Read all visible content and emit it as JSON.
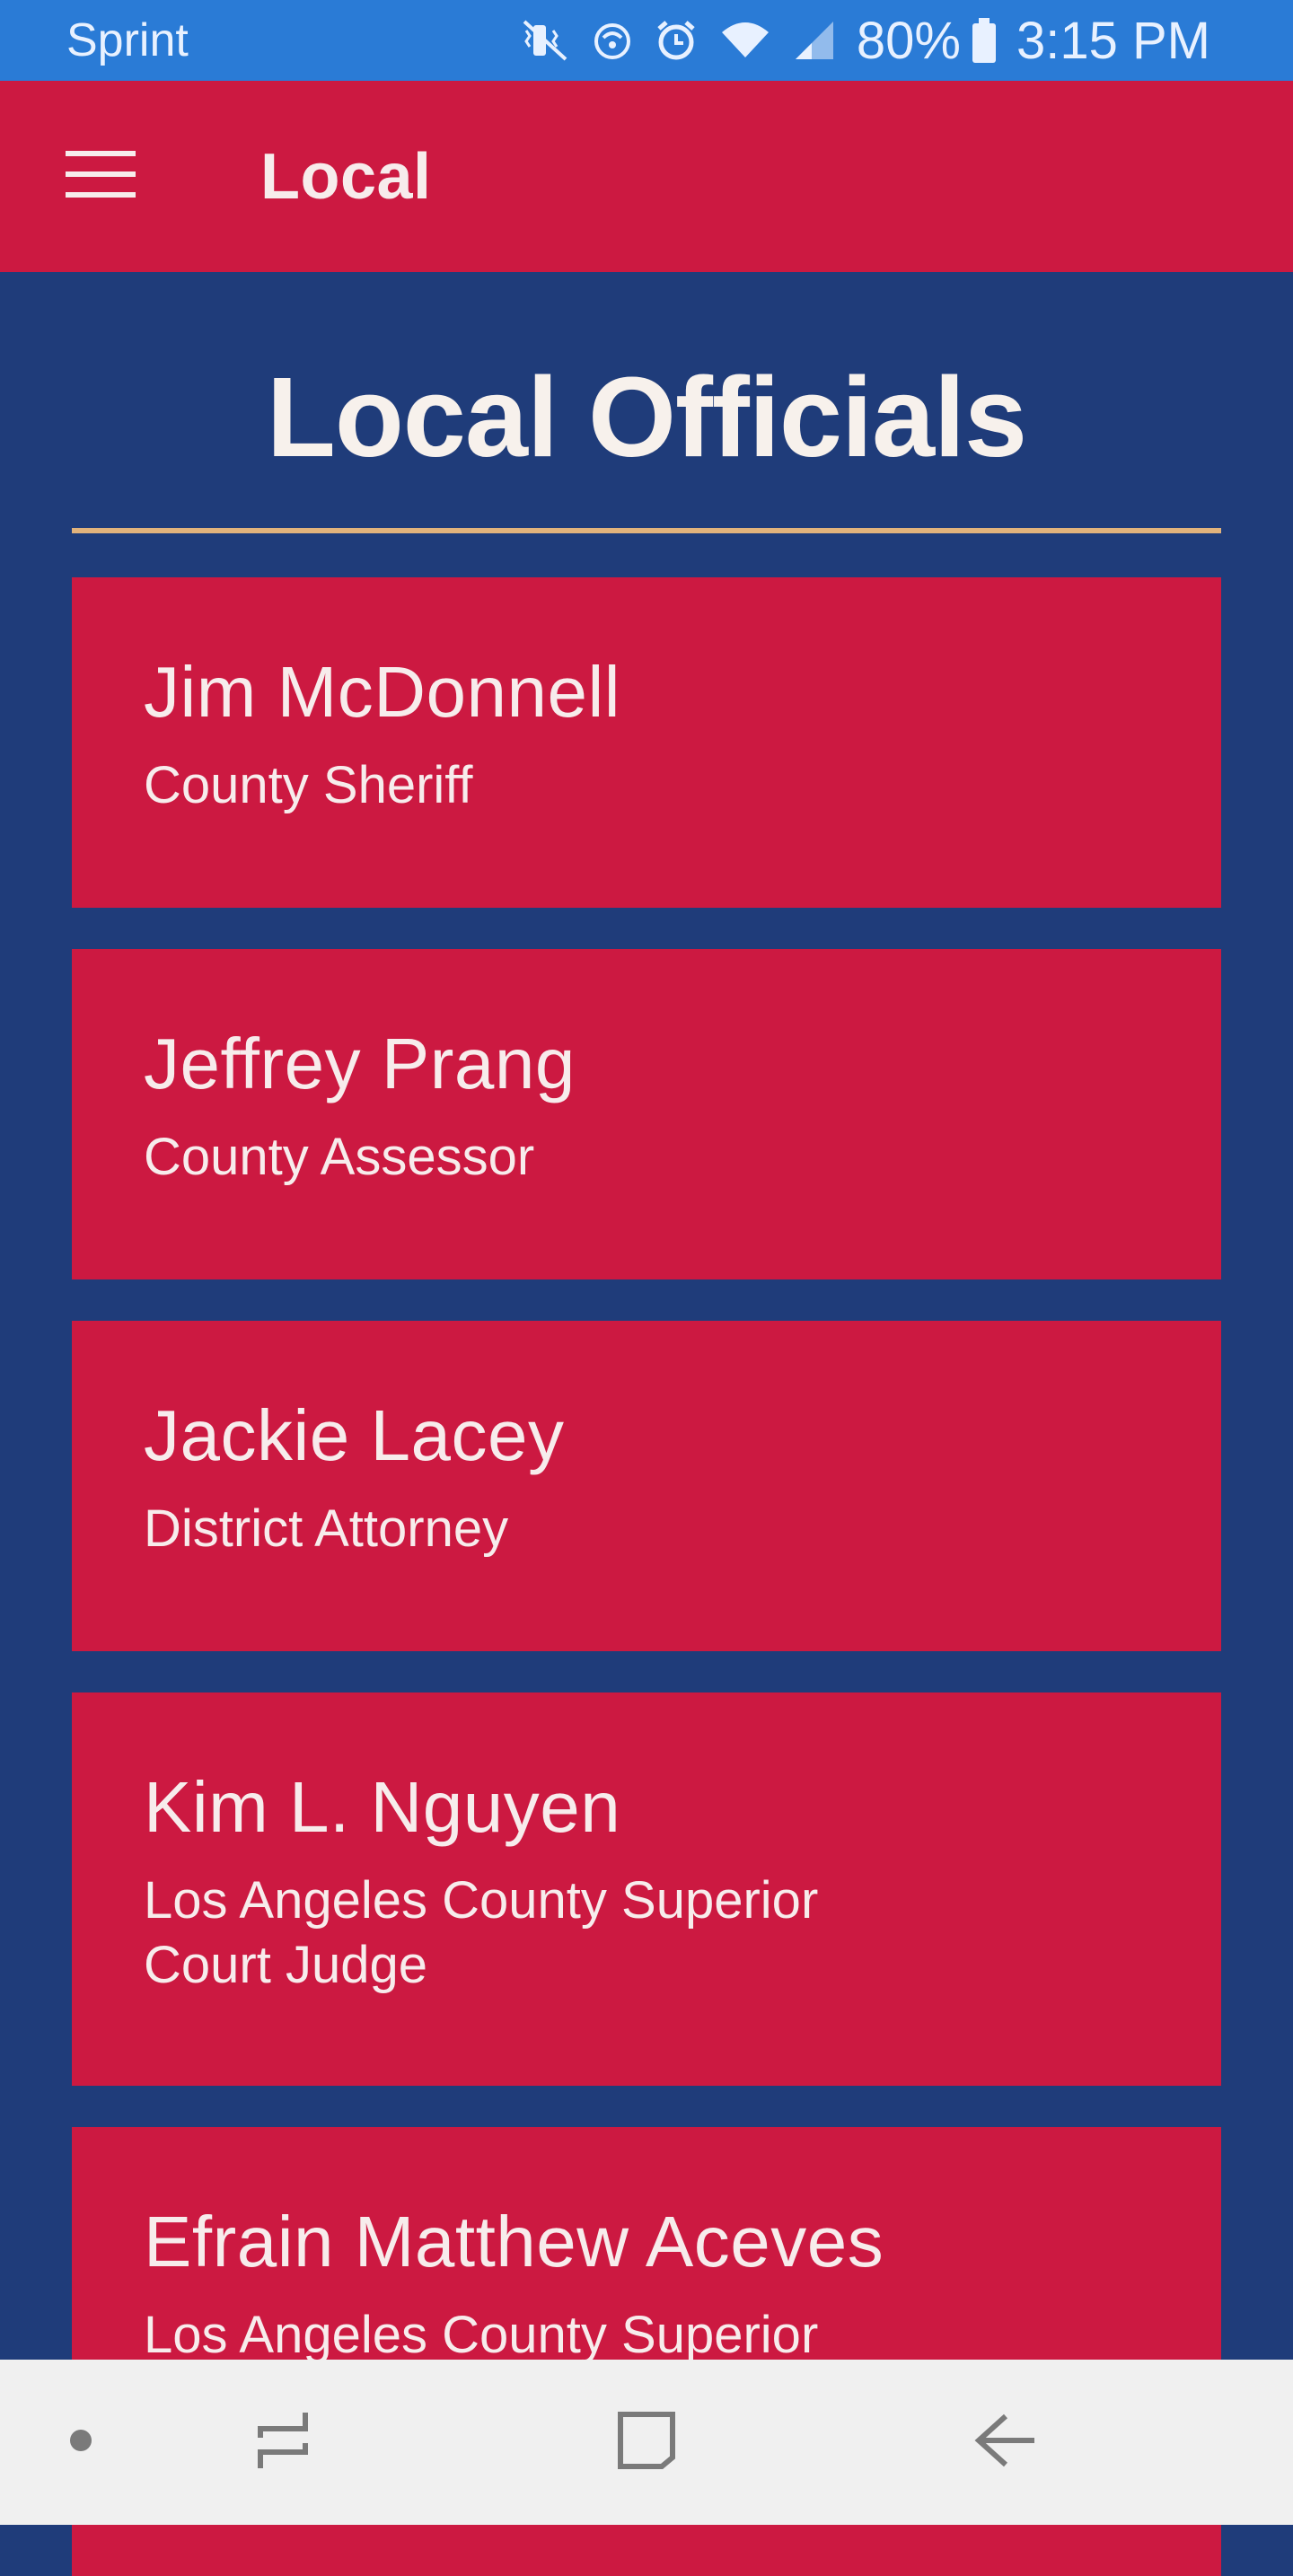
{
  "status_bar": {
    "carrier": "Sprint",
    "battery": "80%",
    "time": "3:15 PM",
    "icons": [
      "mute-vibrate-icon",
      "wifi-calling-icon",
      "alarm-icon",
      "wifi-icon",
      "cellular-signal-icon",
      "battery-icon"
    ]
  },
  "app_bar": {
    "title": "Local",
    "menu_icon": "hamburger-menu-icon"
  },
  "page": {
    "heading": "Local Officials"
  },
  "officials": [
    {
      "name": "Jim McDonnell",
      "title": "County Sheriff"
    },
    {
      "name": "Jeffrey Prang",
      "title": "County Assessor"
    },
    {
      "name": "Jackie Lacey",
      "title": "District Attorney"
    },
    {
      "name": "Kim L. Nguyen",
      "title": "Los Angeles County Superior Court Judge"
    },
    {
      "name": "Efrain Matthew Aceves",
      "title": "Los Angeles County Superior Court Judge"
    }
  ],
  "nav_bar": {
    "icons": [
      "dot-icon",
      "recent-apps-icon",
      "home-icon",
      "back-icon"
    ]
  },
  "colors": {
    "status_bar": "#2a7bd6",
    "app_bar": "#cc1941",
    "background": "#1f3c7a",
    "card": "#cc1941",
    "divider": "#e1b37c",
    "nav_bar": "#f0f0f0"
  }
}
